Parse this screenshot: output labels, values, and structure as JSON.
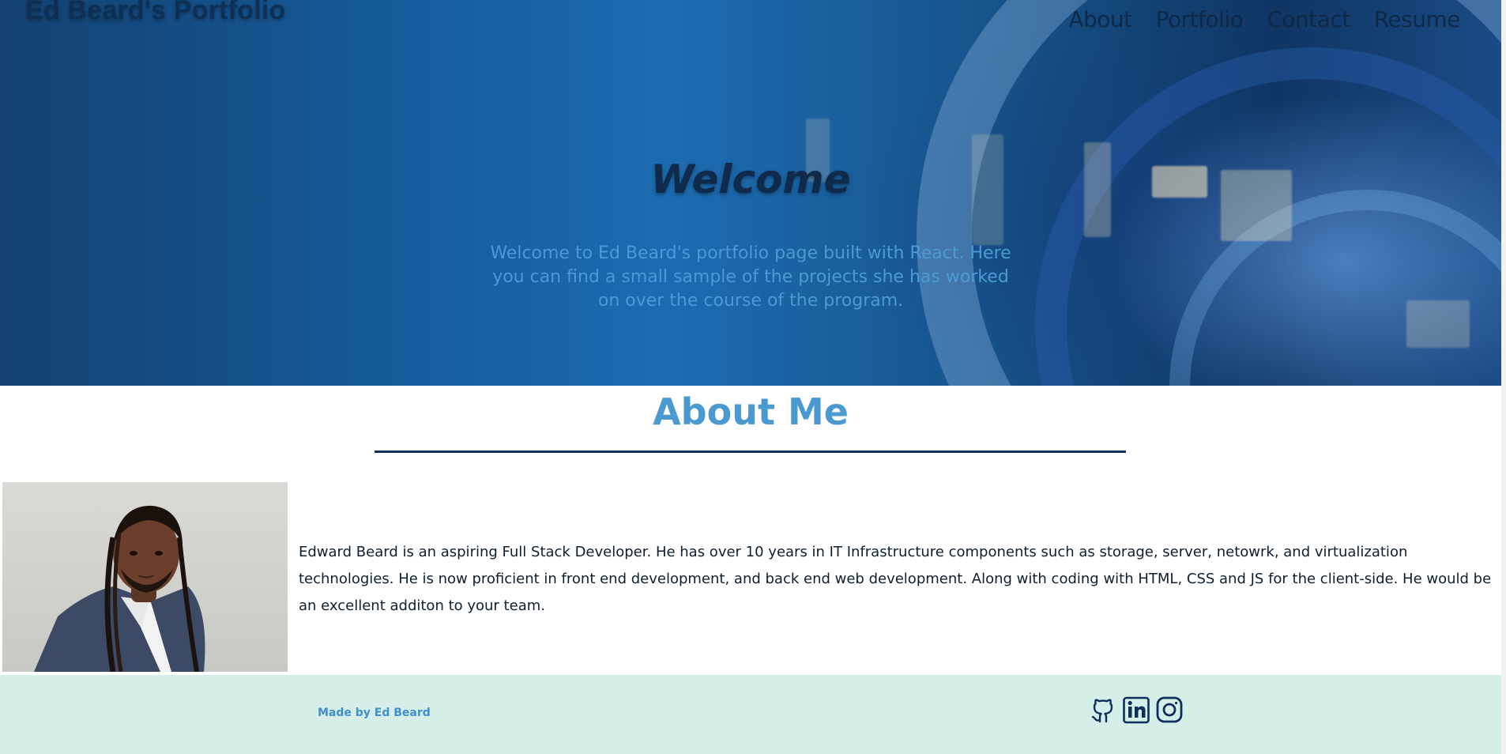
{
  "header": {
    "site_title": "Ed Beard's Portfolio",
    "nav": [
      {
        "label": "About"
      },
      {
        "label": "Portfolio"
      },
      {
        "label": "Contact"
      },
      {
        "label": "Resume"
      }
    ]
  },
  "hero": {
    "title": "Welcome",
    "text": "Welcome to Ed Beard's portfolio page built with React. Here you can find a small sample of the projects she has worked on over the course of the program."
  },
  "about": {
    "heading": "About Me",
    "bio": "Edward Beard is an aspiring Full Stack Developer. He has over 10 years in IT Infrastructure components such as storage, server, netowrk, and virtualization technologies. He is now proficient in front end development, and back end web development. Along with coding with HTML, CSS and JS for the client-side. He would be an excellent additon to your team."
  },
  "footer": {
    "credit": "Made by Ed Beard",
    "social_icons": [
      "github-icon",
      "linkedin-icon",
      "instagram-icon"
    ]
  },
  "colors": {
    "accent": "#4a9acf",
    "rule": "#0e2e5c",
    "footer_bg": "#d5efe8",
    "nav_text": "#0f2540"
  }
}
